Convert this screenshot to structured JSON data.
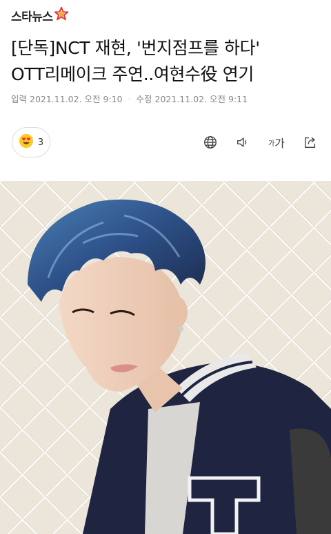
{
  "brand": {
    "name": "스타뉴스",
    "logo_icon": "star-logo-icon",
    "accent": "#e53935"
  },
  "headline": {
    "line1": "[단독]NCT 재현, '번지점프를 하다'",
    "line2": "OTT리메이크 주연..여현수役 연기"
  },
  "meta": {
    "input_label": "입력",
    "input_time": "2021.11.02. 오전 9:10",
    "modify_label": "수정",
    "modify_time": "2021.11.02. 오전 9:11"
  },
  "reaction": {
    "icon": "heart-eyes-emoji-icon",
    "count": "3"
  },
  "toolbar": {
    "globe_icon": "globe-icon",
    "speaker_icon": "speaker-icon",
    "fontsize_small": "가",
    "fontsize_large": "가",
    "share_icon": "share-icon"
  },
  "photo": {
    "description_icon": "article-photo"
  }
}
